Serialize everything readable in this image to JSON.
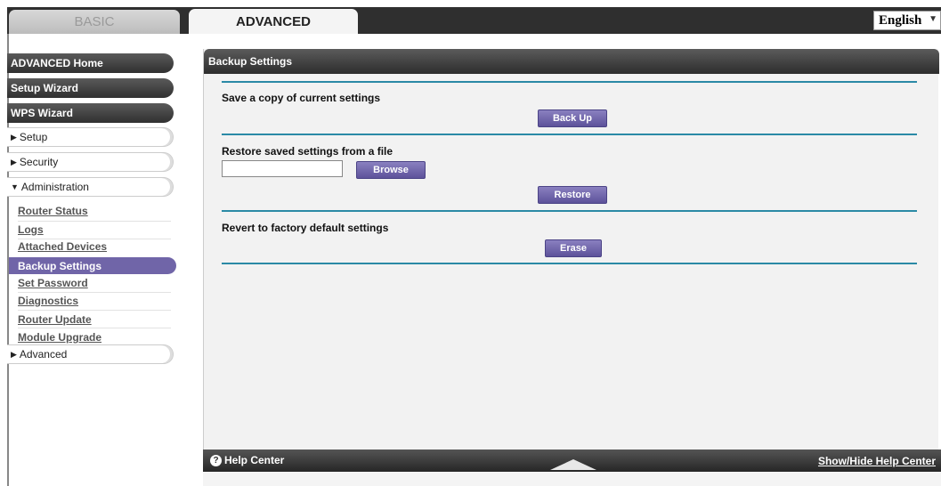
{
  "tabs": {
    "basic": "BASIC",
    "advanced": "ADVANCED"
  },
  "language": {
    "selected": "English"
  },
  "sidebar": {
    "advanced_home": "ADVANCED Home",
    "setup_wizard": "Setup Wizard",
    "wps_wizard": "WPS Wizard",
    "setup": "Setup",
    "security": "Security",
    "administration": "Administration",
    "admin_items": [
      "Router Status",
      "Logs",
      "Attached Devices",
      "Backup Settings",
      "Set Password",
      "Diagnostics",
      "Router Update",
      "Module Upgrade"
    ],
    "advanced": "Advanced"
  },
  "panel": {
    "title": "Backup Settings",
    "save_heading": "Save a copy of current settings",
    "backup_button": "Back Up",
    "restore_heading": "Restore saved settings from a file",
    "browse_button": "Browse",
    "restore_button": "Restore",
    "revert_heading": "Revert to factory default settings",
    "erase_button": "Erase"
  },
  "footer": {
    "help_center": "Help Center",
    "show_hide": "Show/Hide Help Center"
  },
  "colors": {
    "accent": "#7065a8",
    "rule": "#2b8aa6",
    "header": "#2f2f2f"
  }
}
